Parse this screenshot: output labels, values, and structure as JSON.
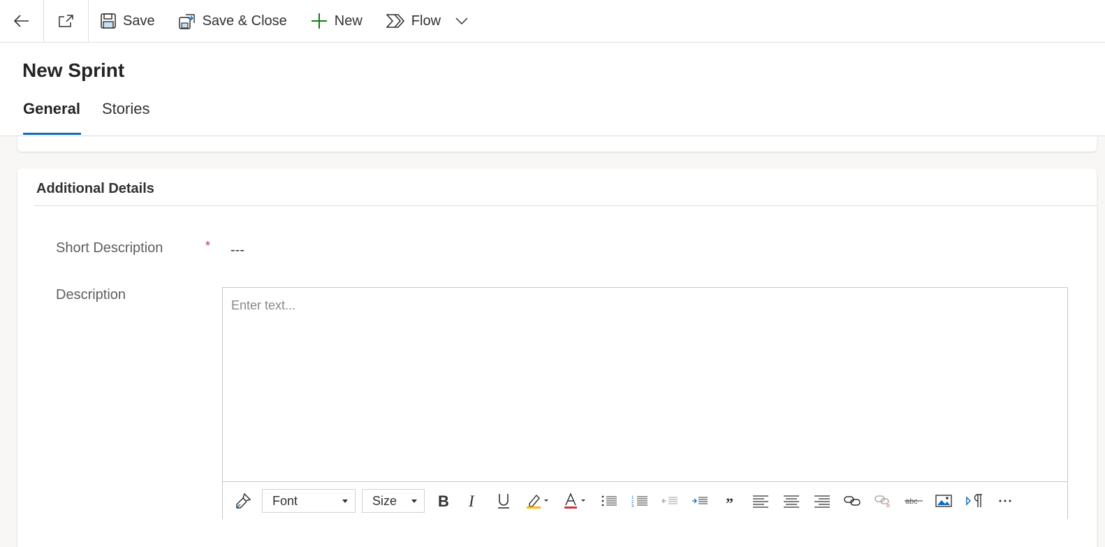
{
  "commandbar": {
    "save_label": "Save",
    "save_close_label": "Save & Close",
    "new_label": "New",
    "flow_label": "Flow"
  },
  "header": {
    "title": "New Sprint",
    "tabs": [
      {
        "label": "General",
        "active": true
      },
      {
        "label": "Stories",
        "active": false
      }
    ]
  },
  "section": {
    "title": "Additional Details",
    "short_description": {
      "label": "Short Description",
      "required_marker": "*",
      "value": "---"
    },
    "description": {
      "label": "Description",
      "placeholder": "Enter text..."
    }
  },
  "editor_toolbar": {
    "font_label": "Font",
    "size_label": "Size",
    "tools": [
      "format-painter-icon",
      "bold-icon",
      "italic-icon",
      "underline-icon",
      "highlight-icon",
      "font-color-icon",
      "bulleted-list-icon",
      "numbered-list-icon",
      "decrease-indent-icon",
      "increase-indent-icon",
      "blockquote-icon",
      "align-left-icon",
      "align-center-icon",
      "align-right-icon",
      "link-icon",
      "unlink-icon",
      "strikethrough-icon",
      "image-icon",
      "text-direction-icon",
      "more-icon"
    ]
  },
  "colors": {
    "accent": "#0f6cbd",
    "new_icon": "#107c10",
    "required": "#c4314b"
  }
}
